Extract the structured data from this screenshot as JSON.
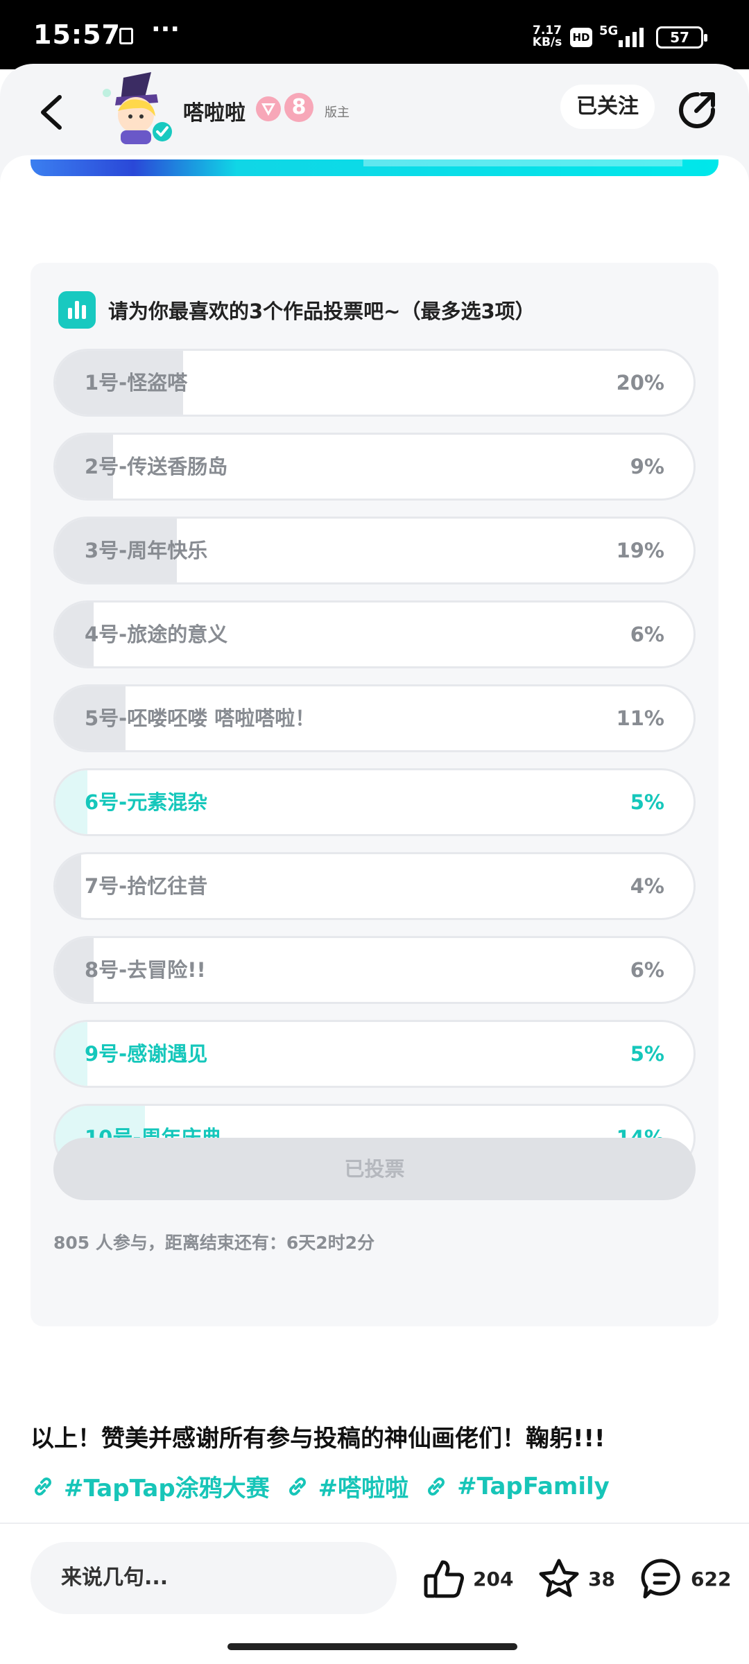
{
  "status_bar": {
    "time": "15:57",
    "dots": "···",
    "speed": "7.17 KB/s",
    "hd": "HD",
    "network": "5G",
    "battery": "57"
  },
  "header": {
    "username": "嗒啦啦",
    "badge_level": "8",
    "role": "版主",
    "follow_label": "已关注"
  },
  "poll": {
    "title": "请为你最喜欢的3个作品投票吧~（最多选3项）",
    "options": [
      {
        "label": "1号-怪盗嗒",
        "percent": "20%",
        "fill": 20,
        "selected": false
      },
      {
        "label": "2号-传送香肠岛",
        "percent": "9%",
        "fill": 9,
        "selected": false
      },
      {
        "label": "3号-周年快乐",
        "percent": "19%",
        "fill": 19,
        "selected": false
      },
      {
        "label": "4号-旅途的意义",
        "percent": "6%",
        "fill": 6,
        "selected": false
      },
      {
        "label": "5号-呸喽呸喽 嗒啦嗒啦！",
        "percent": "11%",
        "fill": 11,
        "selected": false
      },
      {
        "label": "6号-元素混杂",
        "percent": "5%",
        "fill": 5,
        "selected": true
      },
      {
        "label": "7号-拾忆往昔",
        "percent": "4%",
        "fill": 4,
        "selected": false
      },
      {
        "label": "8号-去冒险!!",
        "percent": "6%",
        "fill": 6,
        "selected": false
      },
      {
        "label": "9号-感谢遇见",
        "percent": "5%",
        "fill": 5,
        "selected": true
      },
      {
        "label": "10号-周年庆典",
        "percent": "14%",
        "fill": 14,
        "selected": true
      }
    ],
    "voted_label": "已投票",
    "footer": "805 人参与，距离结束还有：6天2时2分"
  },
  "body_text": "以上！赞美并感谢所有参与投稿的神仙画佬们！鞠躬!!!",
  "tags": [
    "#TapTap涂鸦大赛",
    "#嗒啦啦",
    "#TapFamily"
  ],
  "bottom_bar": {
    "comment_placeholder": "来说几句...",
    "like_count": "204",
    "favorite_count": "38",
    "comment_count": "622"
  },
  "colors": {
    "accent": "#15c7bb",
    "selected_fill": "#e0f8f7",
    "unselected_fill": "#e4e6ea"
  }
}
